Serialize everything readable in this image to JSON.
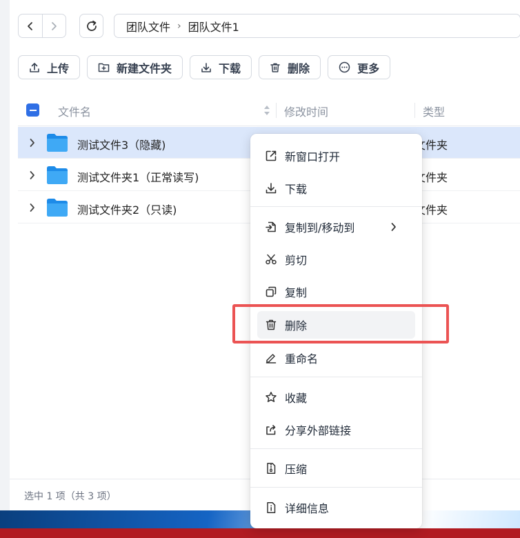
{
  "nav": {
    "back_icon": "chevron-left-icon",
    "forward_icon": "chevron-right-icon",
    "refresh_icon": "refresh-icon"
  },
  "breadcrumb": {
    "items": [
      "团队文件",
      "团队文件1"
    ],
    "separator": "›"
  },
  "toolbar": {
    "upload": "上传",
    "new_folder": "新建文件夹",
    "download": "下载",
    "delete": "删除",
    "more": "更多"
  },
  "table": {
    "columns": {
      "name": "文件名",
      "modified": "修改时间",
      "type": "类型"
    },
    "rows": [
      {
        "name": "测试文件3（隐藏)",
        "type": "文件夹",
        "selected": true
      },
      {
        "name": "测试文件夹1（正常读写)",
        "type": "文件夹",
        "selected": false
      },
      {
        "name": "测试文件夹2（只读)",
        "type": "文件夹",
        "selected": false
      }
    ]
  },
  "status": {
    "text": "选中 1 项（共 3 项）"
  },
  "context_menu": {
    "items": [
      {
        "label": "新窗口打开",
        "icon": "open-new-window-icon"
      },
      {
        "label": "下载",
        "icon": "download-icon"
      },
      {
        "label": "复制到/移动到",
        "icon": "copy-move-icon",
        "has_submenu": true
      },
      {
        "label": "剪切",
        "icon": "scissors-icon"
      },
      {
        "label": "复制",
        "icon": "copy-icon"
      },
      {
        "label": "删除",
        "icon": "trash-icon",
        "hovered": true
      },
      {
        "label": "重命名",
        "icon": "rename-icon"
      },
      {
        "label": "收藏",
        "icon": "star-icon"
      },
      {
        "label": "分享外部链接",
        "icon": "share-icon"
      },
      {
        "label": "压缩",
        "icon": "zip-icon"
      },
      {
        "label": "详细信息",
        "icon": "info-icon"
      }
    ]
  },
  "colors": {
    "accent": "#2f6fe5",
    "selected_row": "#dbe7fb",
    "highlight": "#eb5353",
    "folder": "#2b9af3"
  }
}
